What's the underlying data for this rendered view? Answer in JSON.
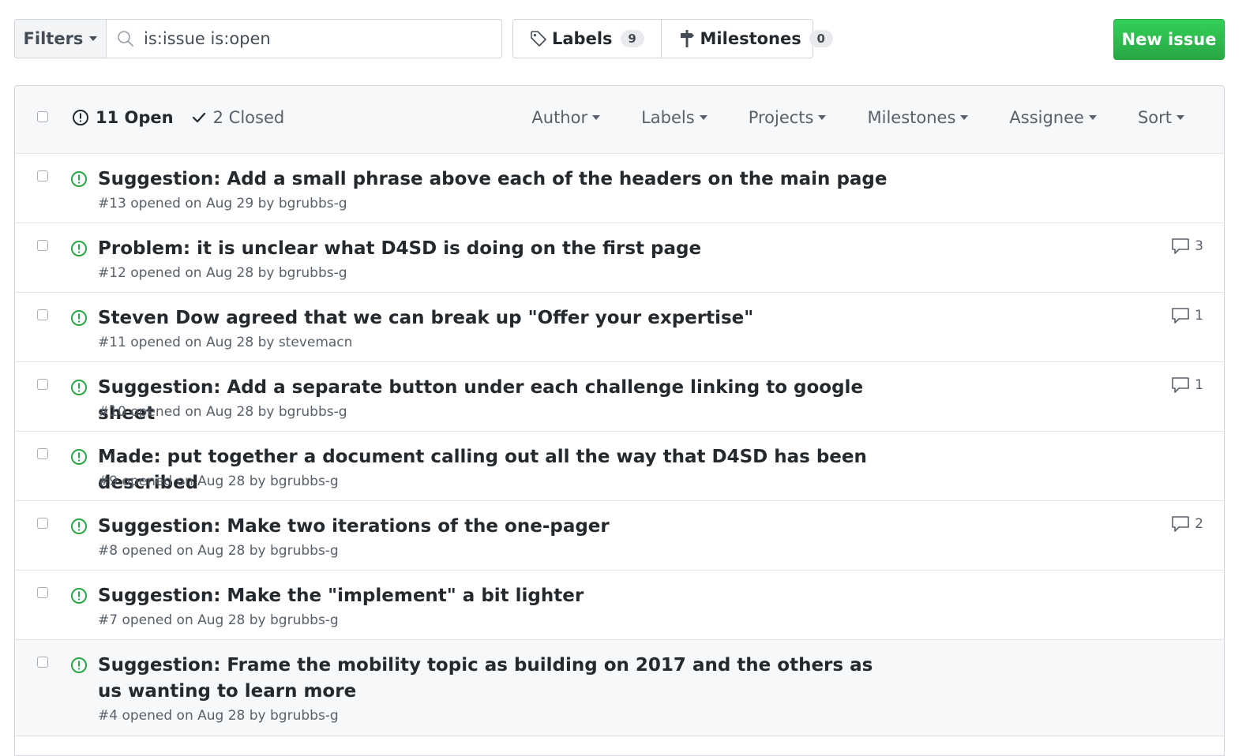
{
  "toolbar": {
    "filters_label": "Filters",
    "search_value": "is:issue is:open",
    "labels_label": "Labels",
    "labels_count": "9",
    "milestones_label": "Milestones",
    "milestones_count": "0",
    "new_issue_label": "New issue"
  },
  "list_header": {
    "open_label": "11 Open",
    "closed_label": "2 Closed",
    "filters": [
      "Author",
      "Labels",
      "Projects",
      "Milestones",
      "Assignee",
      "Sort"
    ]
  },
  "issues": [
    {
      "title": "Suggestion: Add a small phrase above each of the headers on the main page",
      "meta": "#13 opened on Aug 29 by bgrubbs-g",
      "comments": ""
    },
    {
      "title": "Problem: it is unclear what D4SD is doing on the first page",
      "meta": "#12 opened on Aug 28 by bgrubbs-g",
      "comments": "3"
    },
    {
      "title": "Steven Dow agreed that we can break up \"Offer your expertise\"",
      "meta": "#11 opened on Aug 28 by stevemacn",
      "comments": "1"
    },
    {
      "title": "Suggestion: Add a separate button under each challenge linking to google sheet",
      "meta": "#10 opened on Aug 28 by bgrubbs-g",
      "comments": "1"
    },
    {
      "title": "Made: put together a document calling out all the way that D4SD has been described",
      "meta": "#9 opened on Aug 28 by bgrubbs-g",
      "comments": ""
    },
    {
      "title": "Suggestion: Make two iterations of the one-pager",
      "meta": "#8 opened on Aug 28 by bgrubbs-g",
      "comments": "2"
    },
    {
      "title": "Suggestion: Make the \"implement\" a bit lighter",
      "meta": "#7 opened on Aug 28 by bgrubbs-g",
      "comments": ""
    },
    {
      "title": "Suggestion: Frame the mobility topic as building on 2017 and the others as us wanting to learn more",
      "meta": "#4 opened on Aug 28 by bgrubbs-g",
      "comments": ""
    }
  ],
  "colors": {
    "accent_green": "#28a745",
    "text_primary": "#24292e",
    "text_muted": "#586069",
    "border": "#d1d5da"
  }
}
